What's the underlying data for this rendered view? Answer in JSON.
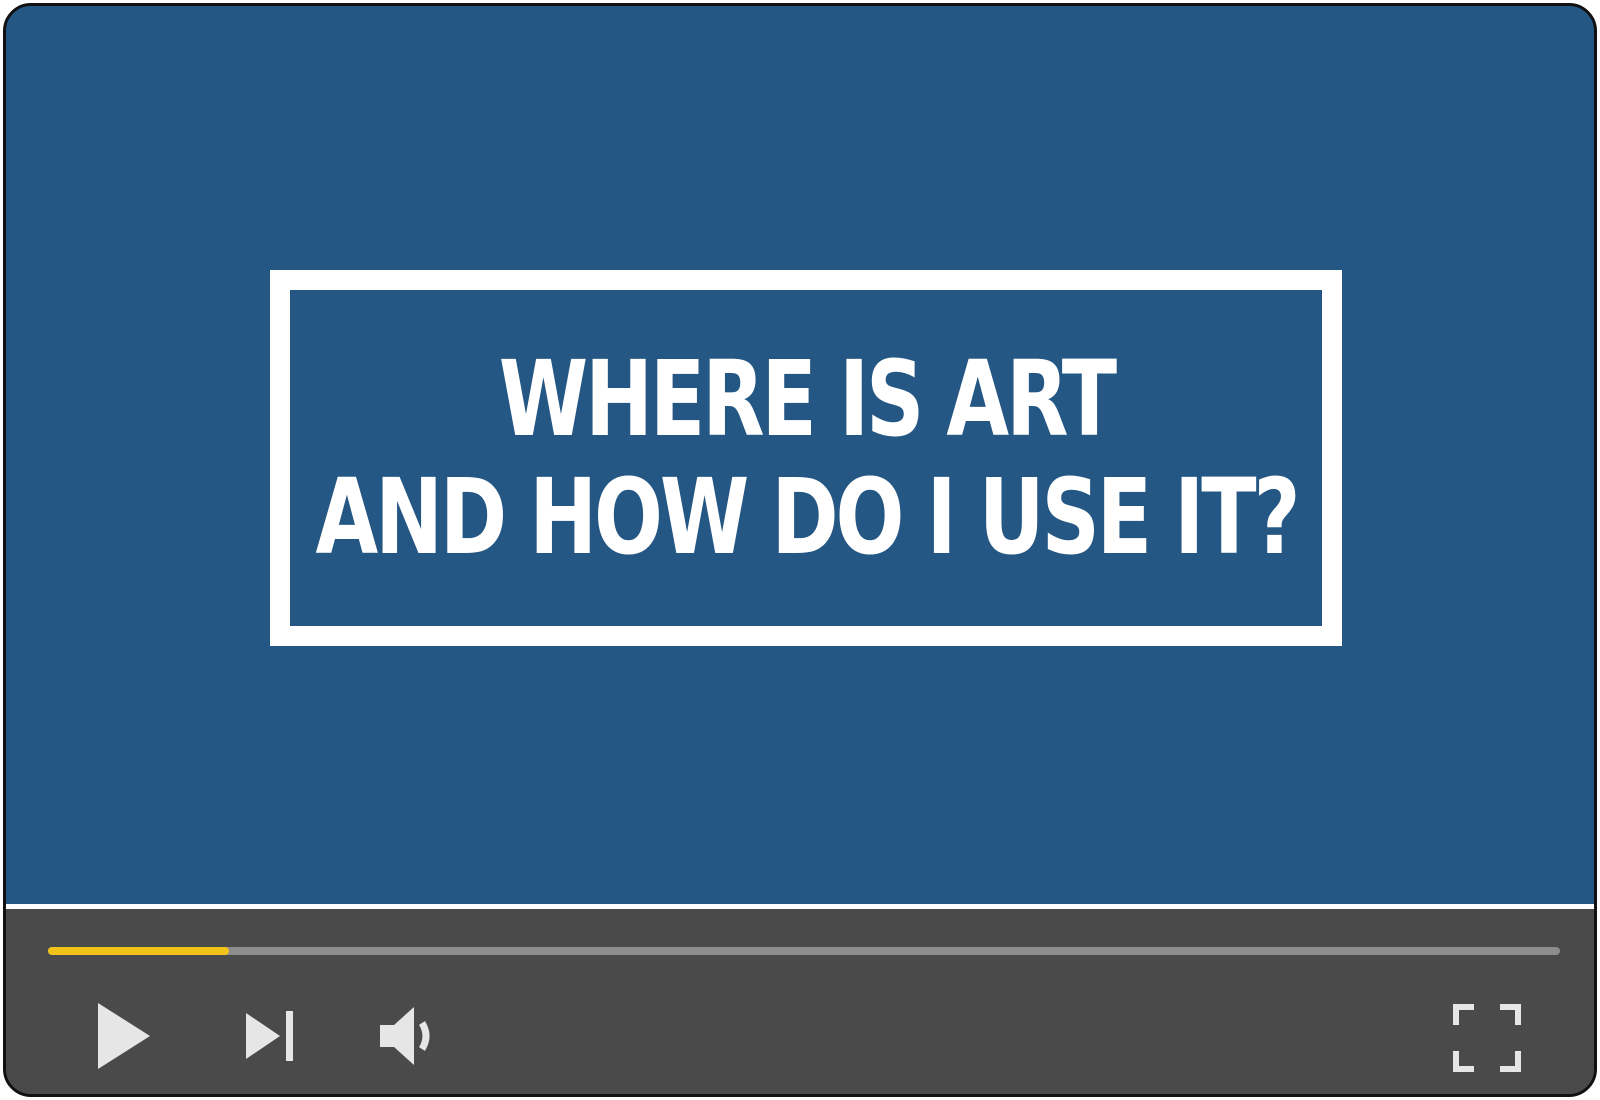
{
  "video": {
    "background_color": "#255784",
    "title_lines": [
      "WHERE IS ART",
      "AND HOW DO I USE IT?"
    ]
  },
  "controls": {
    "progress_fraction": 0.12,
    "progress_color": "#f2c318",
    "track_color": "#8d8d8d",
    "bar_color": "#4a4a4a",
    "icons": [
      "play-icon",
      "skip-next-icon",
      "volume-icon",
      "fullscreen-icon"
    ]
  }
}
